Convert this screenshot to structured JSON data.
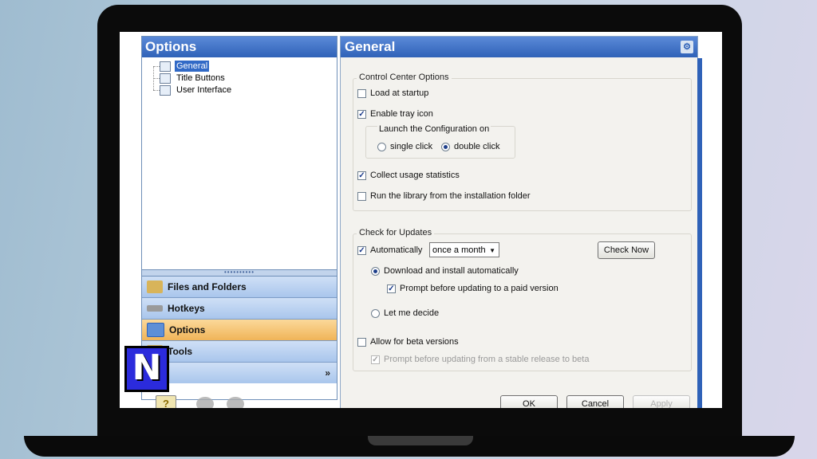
{
  "left_pane": {
    "title": "Options",
    "tree": [
      {
        "label": "General",
        "selected": true,
        "icon": "settings-icon"
      },
      {
        "label": "Title Buttons",
        "selected": false,
        "icon": "window-buttons-icon"
      },
      {
        "label": "User Interface",
        "selected": false,
        "icon": "user-interface-icon"
      }
    ],
    "nav": [
      {
        "label": "Files and Folders",
        "icon": "folder-icon",
        "active": false
      },
      {
        "label": "Hotkeys",
        "icon": "keyboard-icon",
        "active": false
      },
      {
        "label": "Options",
        "icon": "options-icon",
        "active": true
      },
      {
        "label": "Tools",
        "icon": "tools-icon",
        "active": false
      }
    ],
    "expand_glyph": "»"
  },
  "right_pane": {
    "title": "General",
    "control_center": {
      "title": "Control Center Options",
      "load_at_startup": {
        "label": "Load at startup",
        "checked": false
      },
      "enable_tray_icon": {
        "label": "Enable tray icon",
        "checked": true
      },
      "launch_group": {
        "title": "Launch the Configuration on",
        "single_click": {
          "label": "single click",
          "selected": false
        },
        "double_click": {
          "label": "double click",
          "selected": true
        }
      },
      "collect_usage": {
        "label": "Collect usage statistics",
        "checked": true
      },
      "run_library": {
        "label": "Run the library from the installation folder",
        "checked": false
      }
    },
    "updates": {
      "title": "Check for Updates",
      "automatically": {
        "label": "Automatically",
        "checked": true
      },
      "frequency": "once a month",
      "check_now": "Check Now",
      "download_install": {
        "label": "Download and install automatically",
        "selected": true
      },
      "prompt_paid": {
        "label": "Prompt before updating to a paid version",
        "checked": true
      },
      "let_me_decide": {
        "label": "Let me decide",
        "selected": false
      },
      "allow_beta": {
        "label": "Allow for beta versions",
        "checked": false
      },
      "prompt_beta": {
        "label": "Prompt before updating from a stable release to beta",
        "checked": true,
        "disabled": true
      }
    },
    "buttons": {
      "ok": "OK",
      "cancel": "Cancel",
      "apply": "Apply"
    }
  },
  "overlay_logo": "N",
  "colors": {
    "header_blue": "#2f62b8",
    "active_nav": "#f0b458",
    "logo_blue": "#2b2bdc"
  }
}
